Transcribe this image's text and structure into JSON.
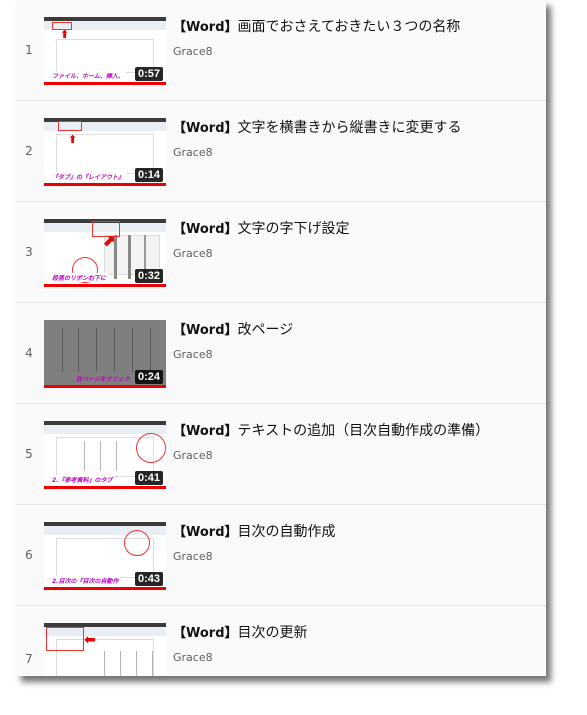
{
  "playlist": {
    "items": [
      {
        "index": "1",
        "title_bracket": "【Word】",
        "title_text": "画面でおさえておきたい３つの名称",
        "channel": "Grace8",
        "duration": "0:57",
        "thumb_caption": "ファイル、ホーム、挿入、"
      },
      {
        "index": "2",
        "title_bracket": "【Word】",
        "title_text": "文字を横書きから縦書きに変更する",
        "channel": "Grace8",
        "duration": "0:14",
        "thumb_caption": "『タブ』の『レイアウト』"
      },
      {
        "index": "3",
        "title_bracket": "【Word】",
        "title_text": "文字の字下げ設定",
        "channel": "Grace8",
        "duration": "0:32",
        "thumb_caption": "段落のリボン右下に"
      },
      {
        "index": "4",
        "title_bracket": "【Word】",
        "title_text": "改ページ",
        "channel": "Grace8",
        "duration": "0:24",
        "thumb_caption": "改ページをクリック"
      },
      {
        "index": "5",
        "title_bracket": "【Word】",
        "title_text": "テキストの追加（目次自動作成の準備）",
        "channel": "Grace8",
        "duration": "0:41",
        "thumb_caption": "2.『参考資料』のタブ"
      },
      {
        "index": "6",
        "title_bracket": "【Word】",
        "title_text": "目次の自動作成",
        "channel": "Grace8",
        "duration": "0:43",
        "thumb_caption": "2.目次の『目次の自動作"
      },
      {
        "index": "7",
        "title_bracket": "【Word】",
        "title_text": "目次の更新",
        "channel": "Grace8",
        "duration": "",
        "thumb_caption": ""
      }
    ]
  },
  "colors": {
    "progress": "#ee0000",
    "caption": "#c000c0",
    "duration_bg": "#000000"
  }
}
